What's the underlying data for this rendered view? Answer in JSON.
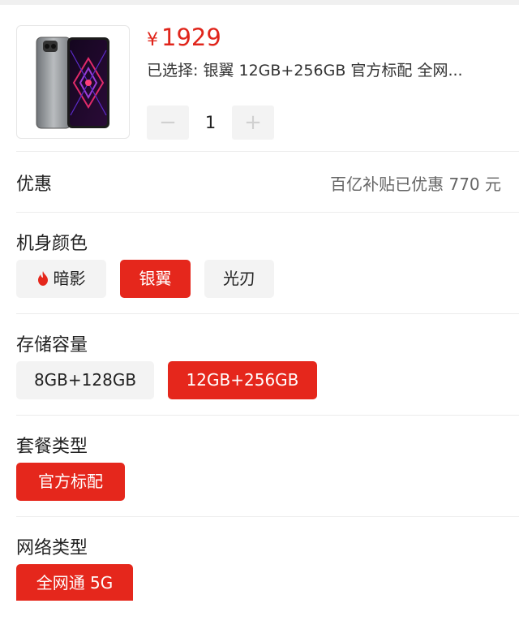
{
  "product": {
    "currency_symbol": "¥",
    "price": "1929",
    "selected_text": "已选择: 银翼 12GB+256GB 官方标配 全网...",
    "quantity": "1",
    "minus_symbol": "−",
    "plus_symbol": "+"
  },
  "promo": {
    "label": "优惠",
    "value": "百亿补贴已优惠 770 元"
  },
  "sections": {
    "color": {
      "title": "机身颜色",
      "options": [
        "暗影",
        "银翼",
        "光刃"
      ],
      "selected": "银翼"
    },
    "storage": {
      "title": "存储容量",
      "options": [
        "8GB+128GB",
        "12GB+256GB"
      ],
      "selected": "12GB+256GB"
    },
    "package": {
      "title": "套餐类型",
      "options": [
        "官方标配"
      ],
      "selected": "官方标配"
    },
    "network": {
      "title": "网络类型",
      "options": [
        "全网通 5G"
      ],
      "selected": "全网通 5G"
    }
  },
  "theme": {
    "accent": "#e5271c",
    "price_color": "#e0251b",
    "unselected_bg": "#f3f3f3"
  },
  "icons": {
    "shadow_option_icon": "flame-icon"
  }
}
